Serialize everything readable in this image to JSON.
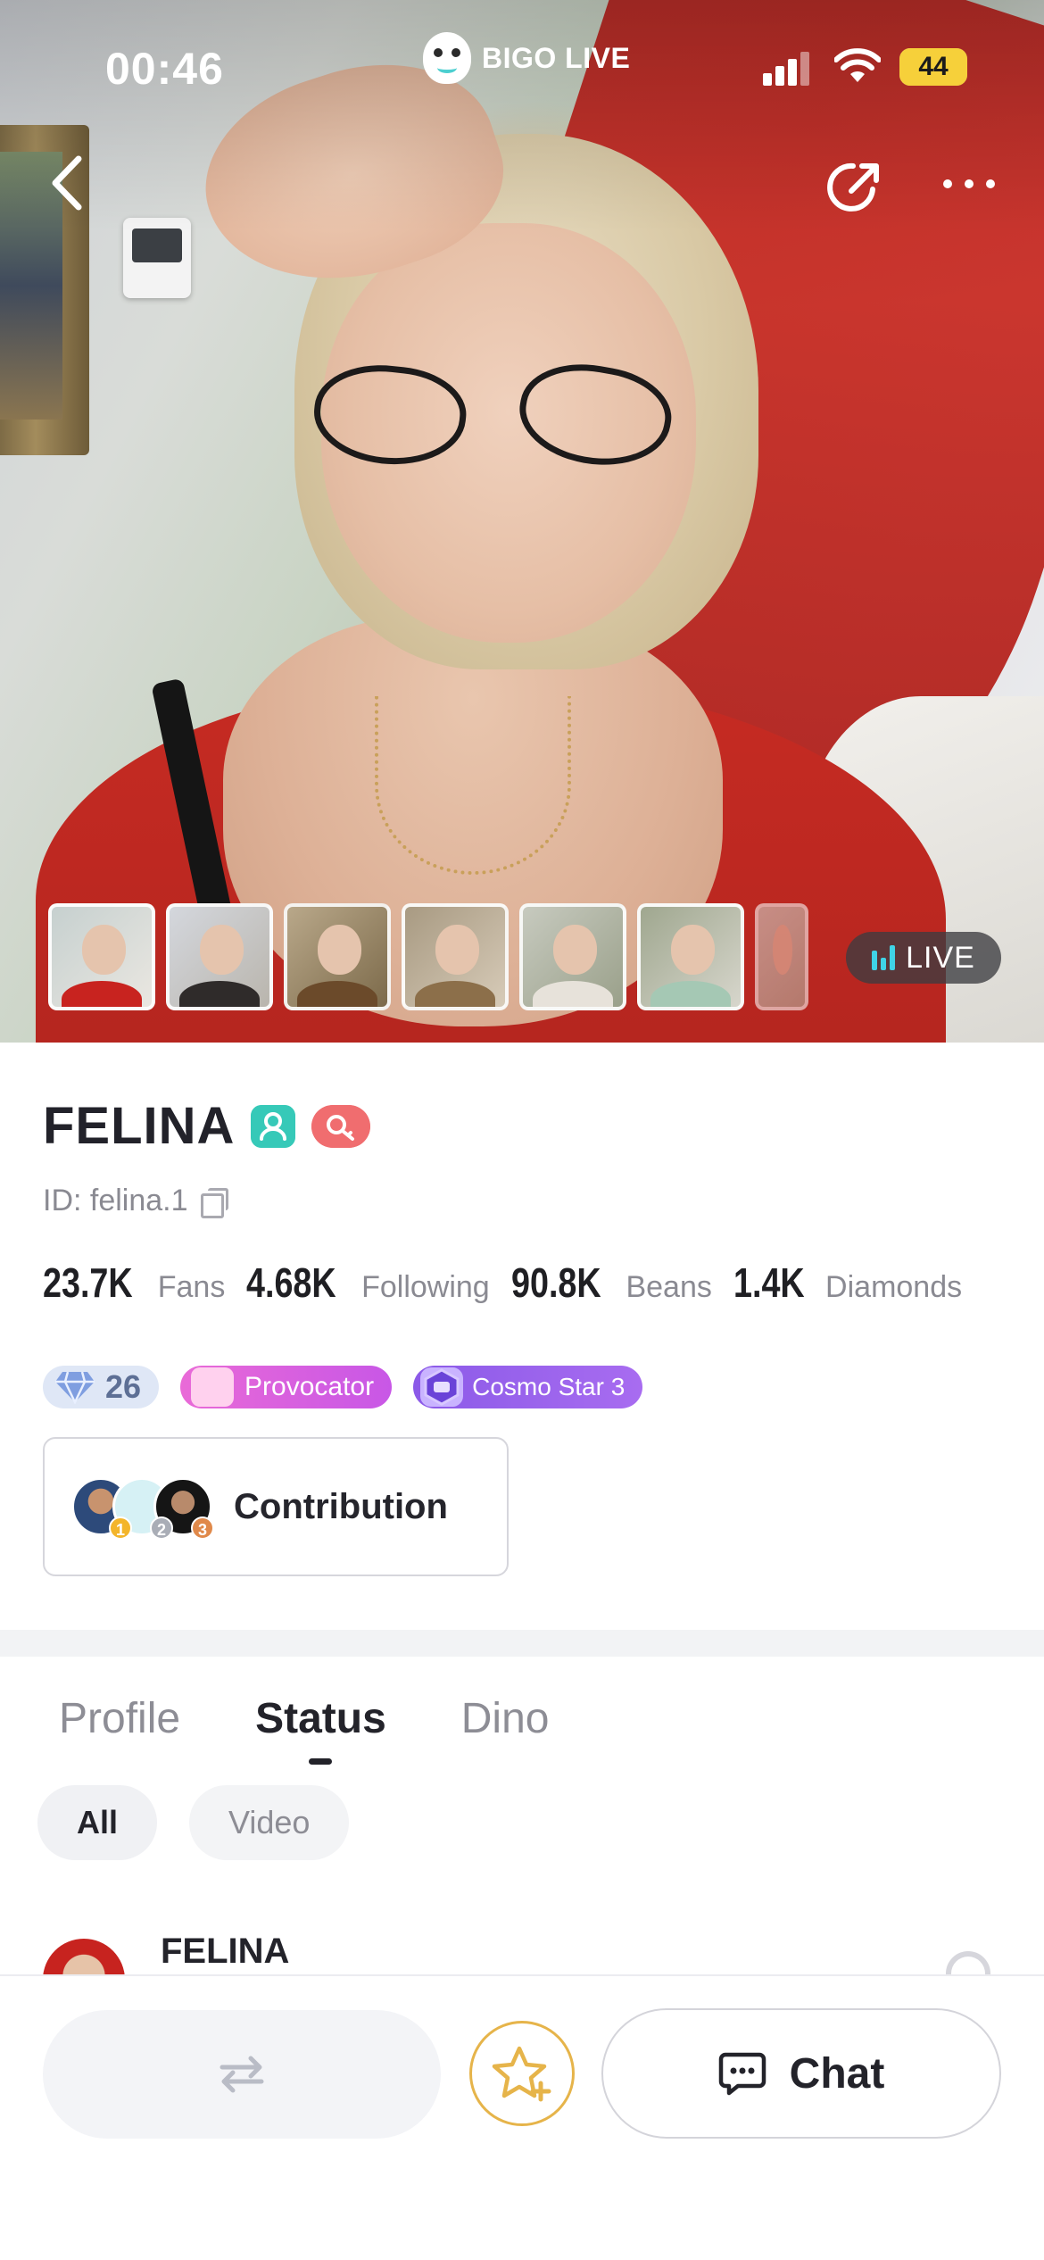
{
  "status_bar": {
    "time": "00:46",
    "brand": "BIGO LIVE",
    "battery": "44"
  },
  "hero": {
    "live_label": "LIVE",
    "thumbnail_count": 7
  },
  "profile": {
    "name": "FELINA",
    "id_text": "ID: felina.1",
    "stats": [
      {
        "value": "23.7K",
        "label": "Fans"
      },
      {
        "value": "4.68K",
        "label": "Following"
      },
      {
        "value": "90.8K",
        "label": "Beans"
      },
      {
        "value": "1.4K",
        "label": "Diamonds"
      }
    ],
    "medals": {
      "level": "26",
      "provocator": "Provocator",
      "cosmo": "Cosmo Star 3"
    },
    "contribution": {
      "label": "Contribution",
      "ranks": [
        "1",
        "2",
        "3"
      ]
    }
  },
  "tabs": [
    "Profile",
    "Status",
    "Dino"
  ],
  "active_tab": "Status",
  "filters": [
    "All",
    "Video"
  ],
  "feed": {
    "first_post_author": "FELINA"
  },
  "bottom_bar": {
    "chat_label": "Chat"
  },
  "colors": {
    "accent_star": "#e6b44a",
    "live_bars": "#3fd3e6",
    "verify_badge": "#36c9b8",
    "key_badge": "#f06d6f"
  },
  "icons": [
    "back-arrow-icon",
    "share-icon",
    "more-icon",
    "copy-icon",
    "live-bars-icon",
    "swap-icon",
    "star-plus-icon",
    "chat-bubble-icon",
    "diamond-icon"
  ]
}
